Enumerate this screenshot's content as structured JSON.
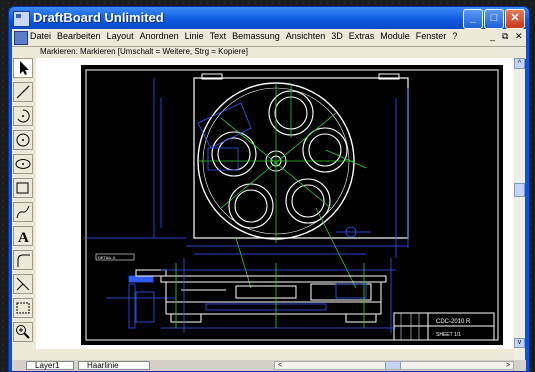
{
  "window": {
    "title": "DraftBoard Unlimited"
  },
  "titlebar_buttons": {
    "minimize": "_",
    "maximize": "□",
    "close": "✕"
  },
  "menu": [
    "Datei",
    "Bearbeiten",
    "Layout",
    "Anordnen",
    "Linie",
    "Text",
    "Bemassung",
    "Ansichten",
    "3D",
    "Extras",
    "Module",
    "Fenster",
    "?"
  ],
  "mdi_controls": {
    "minimize": "_",
    "restore": "⧉",
    "close": "✕"
  },
  "status_text": "Markieren: Markieren  [Umschalt = Weitere, Strg = Kopiere]",
  "tools": [
    {
      "name": "arrow-tool-icon"
    },
    {
      "name": "line-tool-icon"
    },
    {
      "name": "arc-tool-icon"
    },
    {
      "name": "circle-tool-icon"
    },
    {
      "name": "ellipse-tool-icon"
    },
    {
      "name": "rectangle-tool-icon"
    },
    {
      "name": "curve-tool-icon"
    },
    {
      "name": "text-tool-icon"
    },
    {
      "name": "fillet-tool-icon"
    },
    {
      "name": "trim-tool-icon"
    },
    {
      "name": "window-tool-icon"
    },
    {
      "name": "zoom-tool-icon"
    }
  ],
  "bottom": {
    "layer": "Layer1",
    "line_style": "Haarlinie"
  },
  "scroll": {
    "left_arrow": "<",
    "right_arrow": ">",
    "up_arrow": "^",
    "down_arrow": "v"
  },
  "drawing": {
    "label_tl": "DETAIL X",
    "title_block": "CDC-2010 R",
    "title_block_sub": "SHEET 1/1"
  },
  "colors": {
    "drawing_bg": "#000000",
    "outline": "#ffffff",
    "blue": "#2f5bff",
    "green": "#2fd02f"
  }
}
